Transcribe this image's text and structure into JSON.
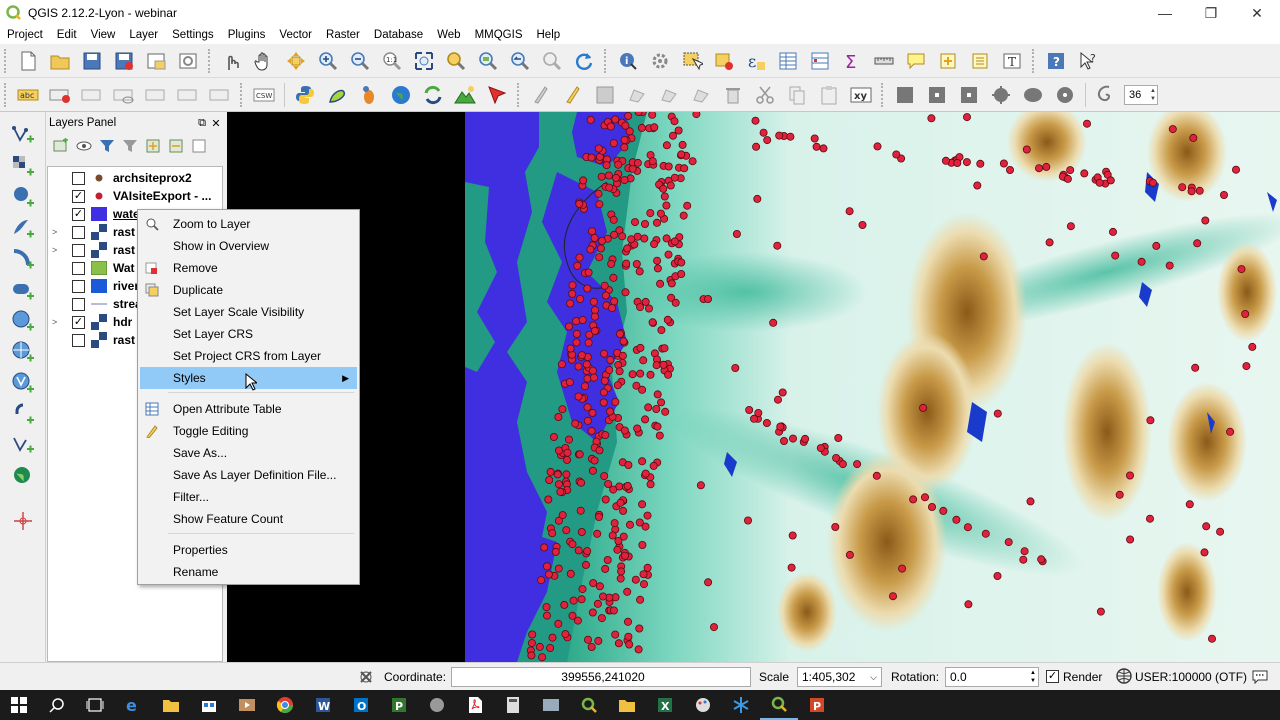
{
  "window": {
    "title": "QGIS 2.12.2-Lyon - webinar"
  },
  "menubar": [
    "Project",
    "Edit",
    "View",
    "Layer",
    "Settings",
    "Plugins",
    "Vector",
    "Raster",
    "Database",
    "Web",
    "MMQGIS",
    "Help"
  ],
  "toolbar2": {
    "label_size_value": "36",
    "csw_label": "CSW",
    "xy_label": "xy",
    "abc_label": "abc"
  },
  "layers_panel": {
    "title": "Layers Panel",
    "layers": [
      {
        "name": "archsiteprox2",
        "checked": false,
        "expander": ""
      },
      {
        "name": "VAIsiteExport - ...",
        "checked": true,
        "expander": ""
      },
      {
        "name": "wate",
        "checked": true,
        "expander": ""
      },
      {
        "name": "rast",
        "checked": false,
        "expander": ">"
      },
      {
        "name": "rast",
        "checked": false,
        "expander": ">"
      },
      {
        "name": "Wat",
        "checked": false,
        "expander": ""
      },
      {
        "name": "river",
        "checked": false,
        "expander": ""
      },
      {
        "name": "strea",
        "checked": false,
        "expander": ""
      },
      {
        "name": "hdr",
        "checked": true,
        "expander": ">"
      },
      {
        "name": "rast",
        "checked": false,
        "expander": ""
      }
    ]
  },
  "context_menu": {
    "items": [
      {
        "label": "Zoom to Layer",
        "icon": "zoom-icon"
      },
      {
        "label": "Show in Overview",
        "icon": ""
      },
      {
        "label": "Remove",
        "icon": "remove-icon"
      },
      {
        "label": "Duplicate",
        "icon": "duplicate-icon"
      },
      {
        "label": "Set Layer Scale Visibility",
        "icon": ""
      },
      {
        "label": "Set Layer CRS",
        "icon": ""
      },
      {
        "label": "Set Project CRS from Layer",
        "icon": ""
      },
      {
        "label": "Styles",
        "icon": "",
        "submenu": true,
        "highlighted": true
      },
      {
        "label": "Open Attribute Table",
        "icon": "table-icon"
      },
      {
        "label": "Toggle Editing",
        "icon": "pencil-icon"
      },
      {
        "label": "Save As...",
        "icon": ""
      },
      {
        "label": "Save As Layer Definition File...",
        "icon": ""
      },
      {
        "label": "Filter...",
        "icon": ""
      },
      {
        "label": "Show Feature Count",
        "icon": ""
      },
      {
        "label": "Properties",
        "icon": ""
      },
      {
        "label": "Rename",
        "icon": ""
      }
    ]
  },
  "statusbar": {
    "coordinate_label": "Coordinate:",
    "coordinate_value": "399556,241020",
    "scale_label": "Scale",
    "scale_value": "1:405,302",
    "rotation_label": "Rotation:",
    "rotation_value": "0.0",
    "render_label": "Render",
    "render_checked": true,
    "crs_label": "USER:100000 (OTF)"
  },
  "colors": {
    "water": "#3f2fe0",
    "sea_green": "#229a84",
    "site_marker": "#e0223c",
    "selection": "#91c9f7"
  }
}
